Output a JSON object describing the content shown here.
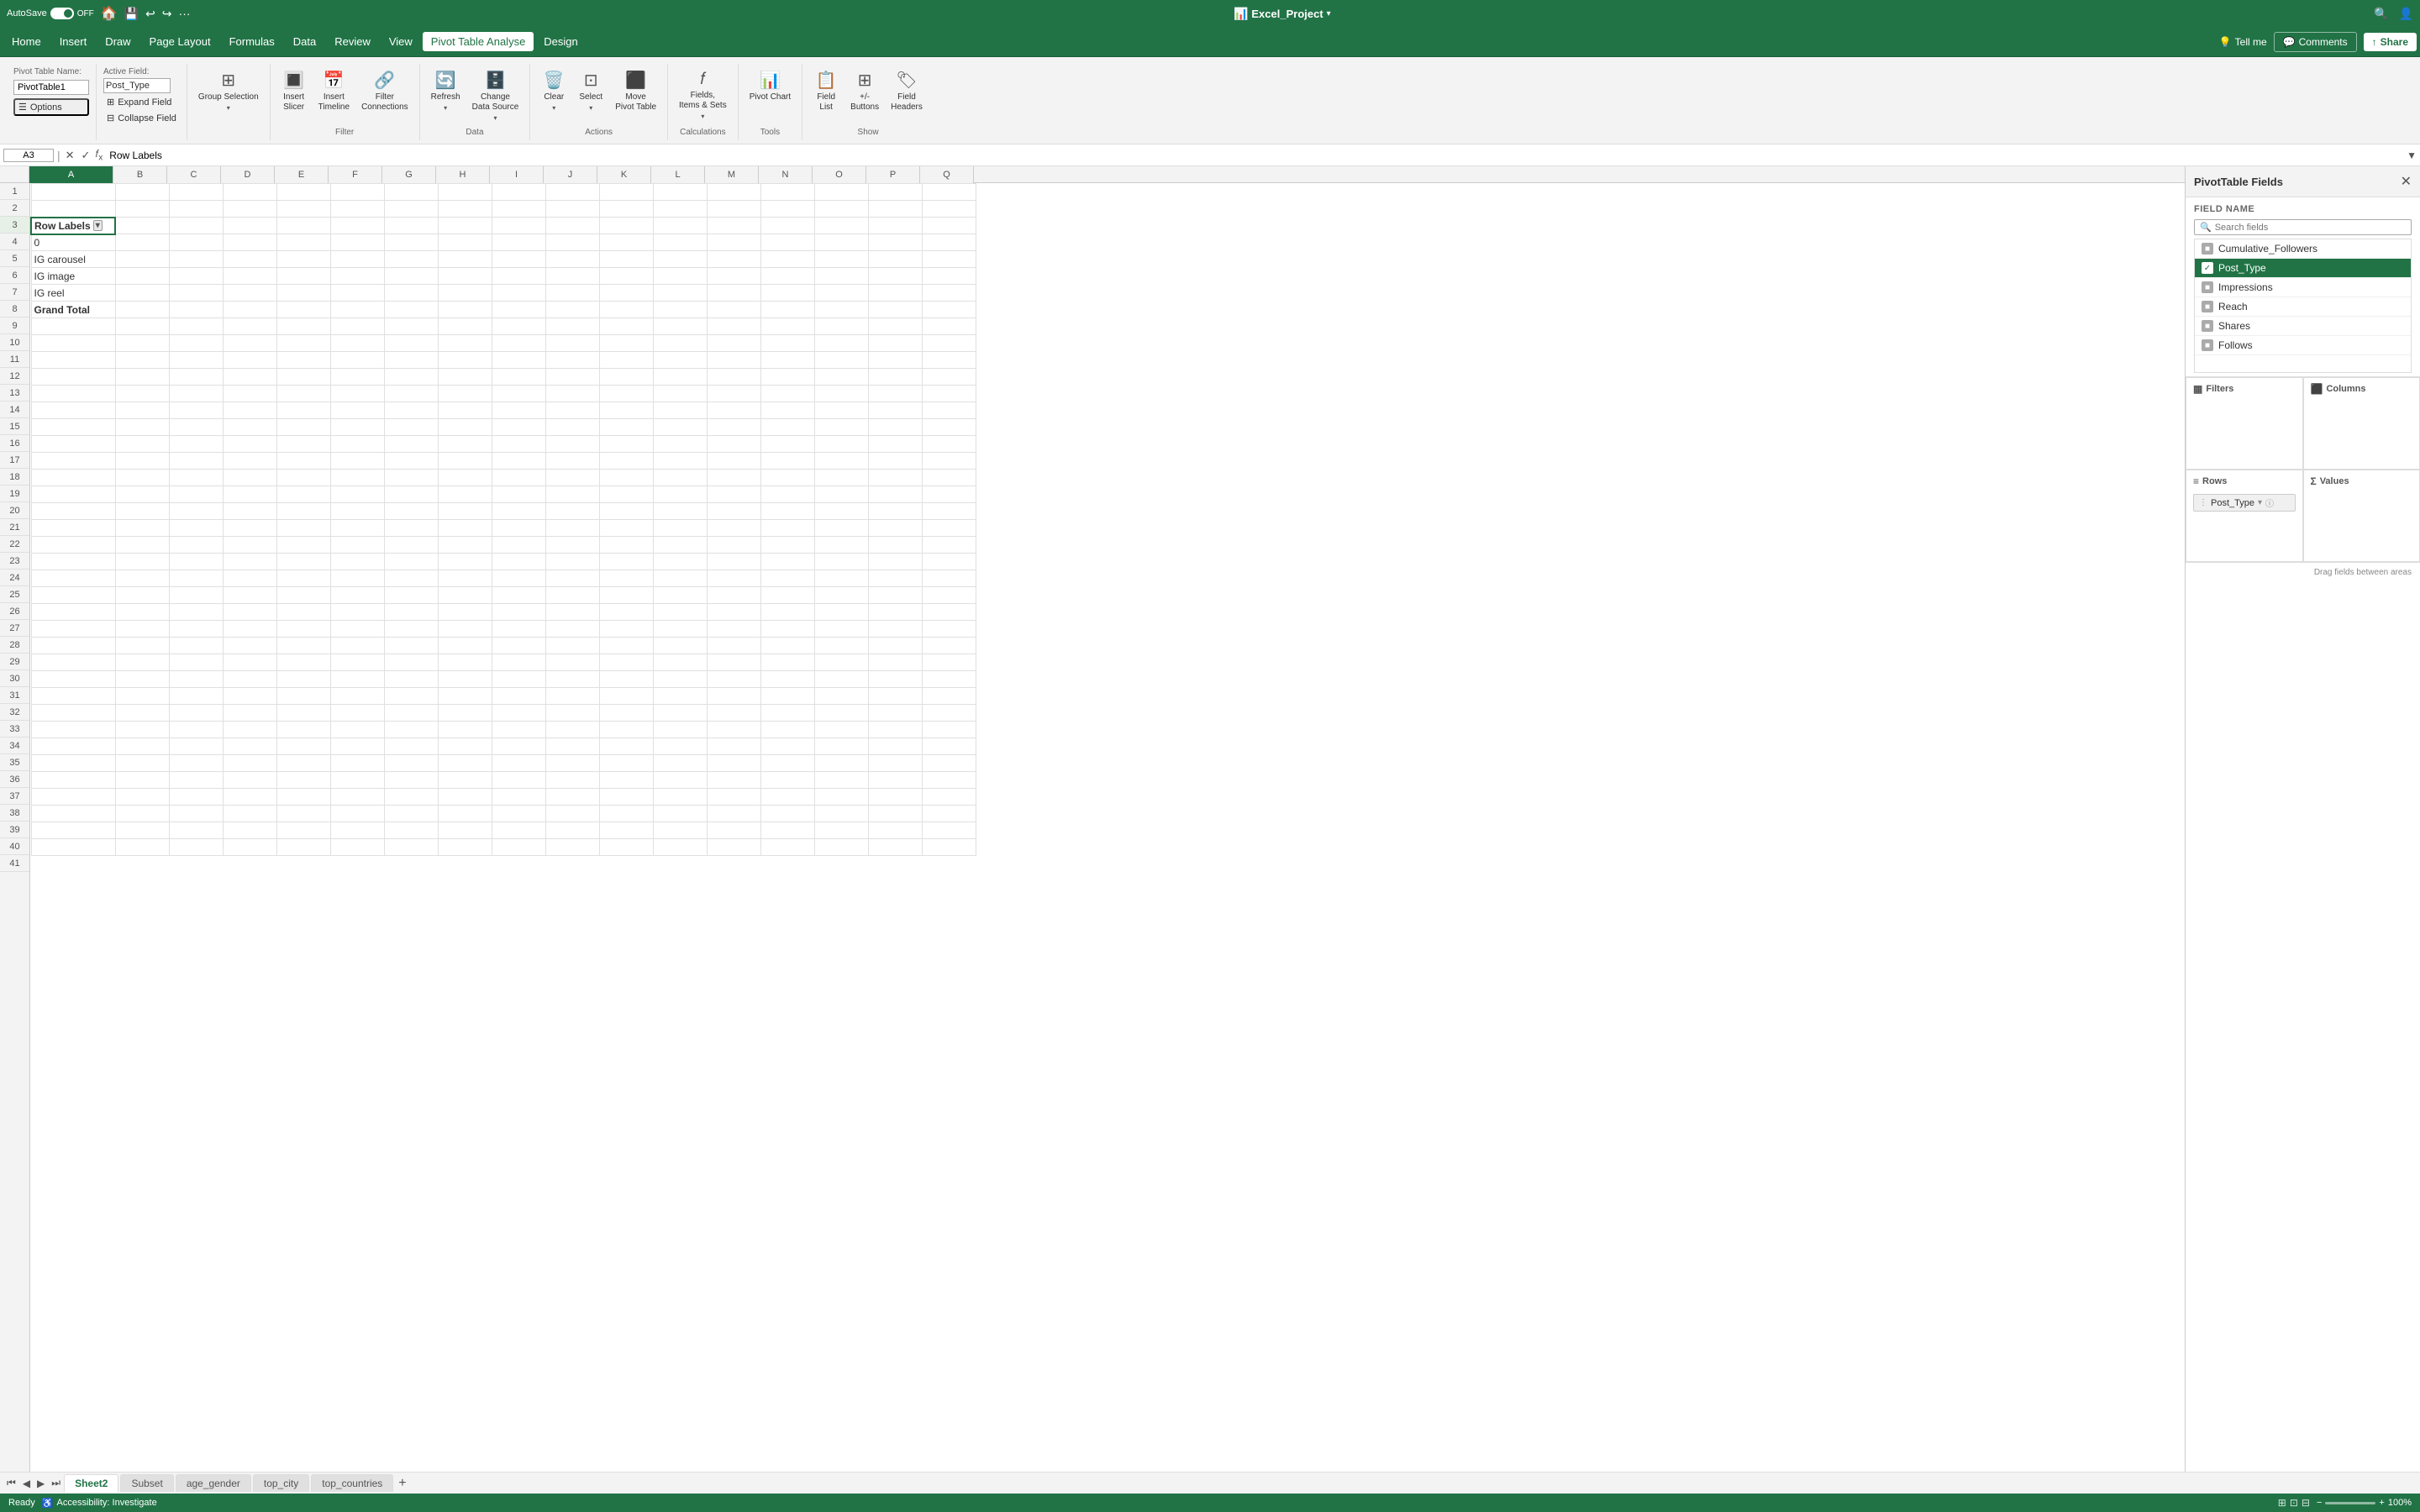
{
  "titleBar": {
    "autosave": "AutoSave",
    "autosave_state": "OFF",
    "filename": "Excel_Project",
    "icons": [
      "home",
      "save",
      "undo",
      "redo",
      "more"
    ],
    "right_icons": [
      "search",
      "settings"
    ]
  },
  "menuBar": {
    "items": [
      "Home",
      "Insert",
      "Draw",
      "Page Layout",
      "Formulas",
      "Data",
      "Review",
      "View",
      "Pivot Table Analyse",
      "Design"
    ],
    "active_item": "Pivot Table Analyse",
    "tell_me": "Tell me",
    "comments": "Comments",
    "share": "Share"
  },
  "ribbon": {
    "pivot_table_name_label": "Pivot Table Name:",
    "pivot_table_name_value": "PivotTable1",
    "active_field_label": "Active Field:",
    "active_field_value": "Post_Type",
    "options_label": "Options",
    "expand_field_label": "Expand Field",
    "collapse_field_label": "Collapse Field",
    "group_selection_label": "Group Selection",
    "group_selection_sublabel": "",
    "insert_slicer_label": "Insert\nSlicer",
    "insert_timeline_label": "Insert\nTimeline",
    "filter_connections_label": "Filter\nConnections",
    "refresh_label": "Refresh",
    "change_data_source_label": "Change\nData Source",
    "clear_label": "Clear",
    "select_label": "Select",
    "move_pivot_table_label": "Move\nPivot Table",
    "fields_items_sets_label": "Fields,\nItems & Sets",
    "pivot_chart_label": "Pivot\nChart",
    "field_list_label": "Field\nList",
    "plus_minus_buttons_label": "+/-\nButtons",
    "field_headers_label": "Field\nHeaders"
  },
  "formulaBar": {
    "cell_ref": "A3",
    "formula_value": "Row Labels",
    "cancel": "✕",
    "confirm": "✓"
  },
  "columns": [
    "A",
    "B",
    "C",
    "D",
    "E",
    "F",
    "G",
    "H",
    "I",
    "J",
    "K",
    "L",
    "M",
    "N",
    "O",
    "P",
    "Q"
  ],
  "rows": [
    "1",
    "2",
    "3",
    "4",
    "5",
    "6",
    "7",
    "8",
    "9",
    "10",
    "11",
    "12",
    "13",
    "14",
    "15",
    "16",
    "17",
    "18",
    "19",
    "20",
    "21",
    "22",
    "23",
    "24",
    "25",
    "26",
    "27",
    "28",
    "29",
    "30",
    "31",
    "32",
    "33",
    "34",
    "35",
    "36",
    "37",
    "38",
    "39",
    "40",
    "41"
  ],
  "cells": {
    "3": {
      "A": "Row Labels",
      "A_is_header": true
    },
    "4": {
      "A": "0"
    },
    "5": {
      "A": "IG carousel"
    },
    "6": {
      "A": "IG image"
    },
    "7": {
      "A": "IG reel"
    },
    "8": {
      "A": "Grand Total",
      "A_is_grand_total": true
    }
  },
  "pivotPanel": {
    "title": "PivotTable Fields",
    "field_name_label": "FIELD NAME",
    "search_placeholder": "Search fields",
    "fields": [
      {
        "name": "Cumulative_Followers",
        "checked": false,
        "active": false
      },
      {
        "name": "Post_Type",
        "checked": true,
        "active": true
      },
      {
        "name": "Impressions",
        "checked": false,
        "active": false
      },
      {
        "name": "Reach",
        "checked": false,
        "active": false
      },
      {
        "name": "Shares",
        "checked": false,
        "active": false
      },
      {
        "name": "Follows",
        "checked": false,
        "active": false
      }
    ],
    "areas": {
      "filters_label": "Filters",
      "columns_label": "Columns",
      "rows_label": "Rows",
      "values_label": "Values",
      "rows_chips": [
        "Post_Type"
      ],
      "values_chips": []
    },
    "footer": "Drag fields between areas"
  },
  "sheetTabs": {
    "tabs": [
      "Sheet2",
      "Subset",
      "age_gender",
      "top_city",
      "top_countries"
    ],
    "active_tab": "Sheet2"
  },
  "statusBar": {
    "ready": "Ready",
    "accessibility": "Accessibility: Investigate",
    "zoom": "100%"
  }
}
